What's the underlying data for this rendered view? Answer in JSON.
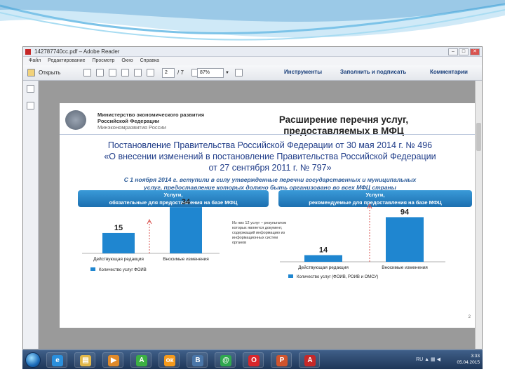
{
  "window": {
    "title": "142787740сс.pdf – Adobe Reader",
    "controls": [
      "–",
      "□",
      "✕"
    ]
  },
  "menu": [
    "Файл",
    "Редактирование",
    "Просмотр",
    "Окно",
    "Справка"
  ],
  "toolbar": {
    "open_label": "Открыть",
    "page_current": "2",
    "page_total": "/ 7",
    "zoom": "87%",
    "tools_label": "Инструменты",
    "fill_sign_label": "Заполнить и подписать",
    "comments_label": "Комментарии"
  },
  "slide": {
    "ministry_line1": "Министерство экономического развития",
    "ministry_line2": "Российской Федерации",
    "ministry_line3": "Минэкономразвития России",
    "title_line1": "Расширение перечня услуг,",
    "title_line2": "предоставляемых в МФЦ",
    "decree_line1": "Постановление Правительства Российской Федерации от 30 мая 2014 г. № 496",
    "decree_line2": "«О внесении изменений в постановление Правительства Российской Федерации",
    "decree_line3": "от 27 сентября 2011 г. № 797»",
    "notice_line1": "С 1 ноября 2014 г. вступили в силу утвержденные перечни государственных и муниципальных",
    "notice_line2": "услуг, предоставление которых должно быть организовано во всех МФЦ страны",
    "banner_left_line1": "Услуги,",
    "banner_left_line2": "обязательные для предоставления на базе МФЦ",
    "banner_right_line1": "Услуги,",
    "banner_right_line2": "рекомендуемые для предоставления на базе МФЦ",
    "note_text": "Из них 12 услуг – результатом которых является документ, содержащий информацию из информационных систем органов",
    "page_number": "2"
  },
  "chart_data": [
    {
      "type": "bar",
      "categories": [
        "Действующая редакция",
        "Вносимые изменения"
      ],
      "series": [
        {
          "name": "Количество услуг ФОИВ",
          "values": [
            15,
            34
          ]
        }
      ],
      "ylim": [
        0,
        40
      ],
      "legend": "bottom",
      "color": "#1f86d0"
    },
    {
      "type": "bar",
      "categories": [
        "Действующая редакция",
        "Вносимые изменения"
      ],
      "series": [
        {
          "name": "Количество услуг (ФОИВ, РОИВ и ОМСУ)",
          "values": [
            14,
            94
          ]
        }
      ],
      "ylim": [
        0,
        110
      ],
      "legend": "bottom",
      "color": "#1f86d0"
    }
  ],
  "taskbar": {
    "apps": [
      {
        "icon": "ie-icon",
        "glyph": "e",
        "color": "#2a8fdc"
      },
      {
        "icon": "explorer-icon",
        "glyph": "▤",
        "color": "#e2b84a"
      },
      {
        "icon": "media-player-icon",
        "glyph": "▶",
        "color": "#e08a2a"
      },
      {
        "icon": "green-a-icon",
        "glyph": "A",
        "color": "#3cb043"
      },
      {
        "icon": "odnoklassniki-icon",
        "glyph": "ок",
        "color": "#f59a1c"
      },
      {
        "icon": "vk-icon",
        "glyph": "B",
        "color": "#4a76a8"
      },
      {
        "icon": "email-icon",
        "glyph": "@",
        "color": "#2fa84f"
      },
      {
        "icon": "opera-icon",
        "glyph": "O",
        "color": "#d9262b"
      },
      {
        "icon": "presentation-icon",
        "glyph": "P",
        "color": "#d0542d"
      },
      {
        "icon": "acrobat-icon",
        "glyph": "A",
        "color": "#c62828"
      }
    ],
    "lang": "RU",
    "time": "3:33",
    "date": "05.04.2015"
  }
}
